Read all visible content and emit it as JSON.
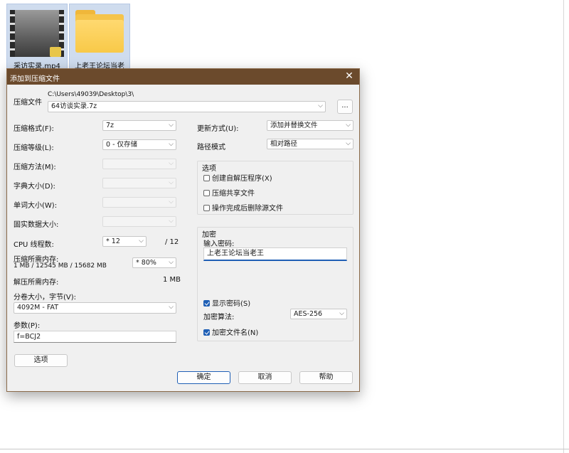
{
  "desktop": {
    "icons": [
      {
        "label": "采访实录.mp4",
        "icon": "video-thumbnail-icon"
      },
      {
        "label": "上老王论坛当老",
        "icon": "folder-icon"
      }
    ]
  },
  "dialog": {
    "title": "添加到压缩文件",
    "archive": {
      "label": "压缩文件",
      "path": "C:\\Users\\49039\\Desktop\\3\\",
      "name": "64访谈实录.7z",
      "browse_label": "..."
    },
    "left": {
      "format": {
        "label": "压缩格式(F):",
        "value": "7z"
      },
      "level": {
        "label": "压缩等级(L):",
        "value": "0 - 仅存储"
      },
      "method": {
        "label": "压缩方法(M):",
        "value": ""
      },
      "dict": {
        "label": "字典大小(D):",
        "value": ""
      },
      "word": {
        "label": "单词大小(W):",
        "value": ""
      },
      "solid": {
        "label": "固实数据大小:",
        "value": ""
      },
      "cpu": {
        "label": "CPU 线程数:",
        "value": "* 12",
        "max": "/ 12"
      },
      "mem_compress": {
        "label": "压缩所需内存:",
        "detail": "1 MB / 12545 MB / 15682 MB",
        "value": "* 80%"
      },
      "mem_decompress": {
        "label": "解压所需内存:",
        "value": "1 MB"
      },
      "volume": {
        "label": "分卷大小，字节(V):",
        "value": "4092M - FAT"
      },
      "params": {
        "label": "参数(P):",
        "value": "f=BCJ2"
      },
      "options_button": "选项"
    },
    "right": {
      "update": {
        "label": "更新方式(U):",
        "value": "添加并替换文件"
      },
      "pathmode": {
        "label": "路径模式",
        "value": "相对路径"
      },
      "options_group": {
        "title": "选项",
        "sfx": {
          "label": "创建自解压程序(X)",
          "checked": false
        },
        "shared": {
          "label": "压缩共享文件",
          "checked": false
        },
        "delete": {
          "label": "操作完成后删除源文件",
          "checked": false
        }
      },
      "encryption": {
        "title": "加密",
        "password_label": "输入密码:",
        "password_value": "上老王论坛当老王",
        "show_password": {
          "label": "显示密码(S)",
          "checked": true
        },
        "method_label": "加密算法:",
        "method_value": "AES-256",
        "encrypt_names": {
          "label": "加密文件名(N)",
          "checked": true
        }
      }
    },
    "buttons": {
      "ok": "确定",
      "cancel": "取消",
      "help": "帮助"
    }
  },
  "colors": {
    "titlebar": "#6b4a2c",
    "accent": "#1f5fb5",
    "dialog_bg": "#f0f0f0"
  }
}
